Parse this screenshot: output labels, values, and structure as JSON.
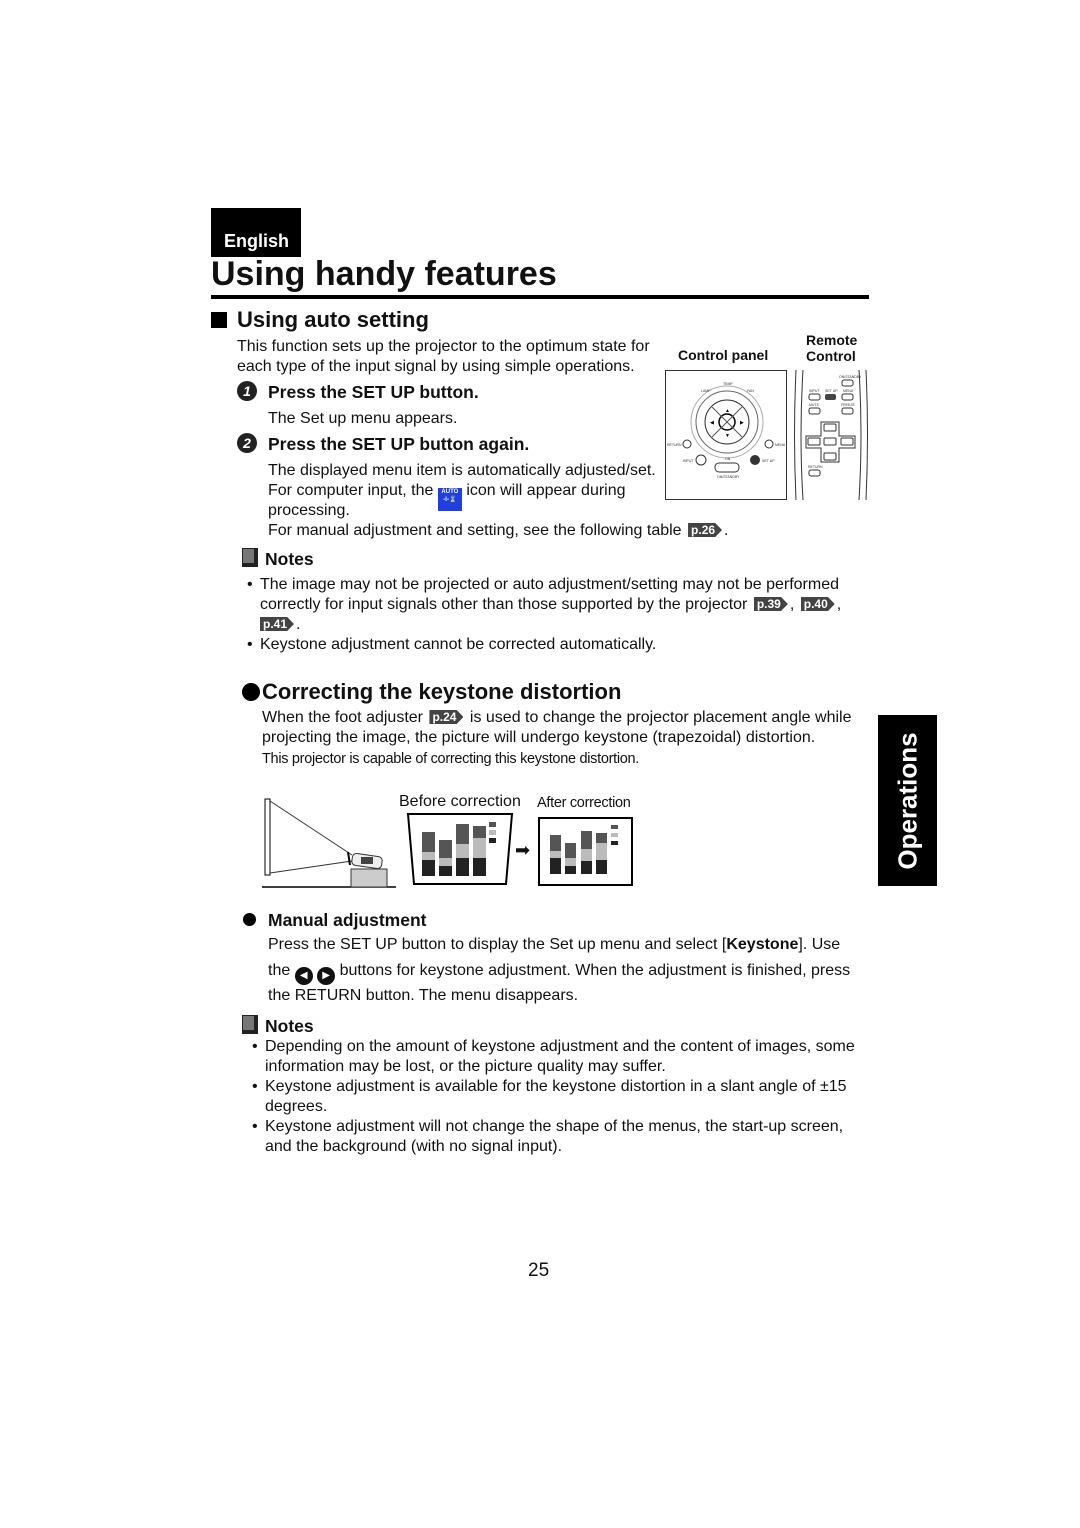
{
  "header": {
    "language_tab": "English",
    "title": "Using handy features"
  },
  "section1": {
    "heading": "Using auto setting",
    "intro": [
      "This function sets up the projector to the optimum state for",
      "each type of the input signal by using simple operations."
    ],
    "control_panel_label": "Control panel",
    "remote_label": [
      "Remote",
      "Control"
    ],
    "control_panel_labels": {
      "lamp": "LAMP",
      "temp": "TEMP",
      "fan": "FAN",
      "return": "RETURN",
      "menu": "MENU",
      "input": "INPUT",
      "on": "ON",
      "setup": "SET UP",
      "standby": "ON/STANDBY"
    },
    "remote_labels": {
      "standby": "ON/STANDBY",
      "input": "INPUT",
      "setup": "SET UP",
      "menu": "MENU",
      "mute": "MUTE",
      "freeze": "FREEZE",
      "return": "RETURN"
    },
    "steps": [
      {
        "number": "1",
        "title": "Press the SET UP button.",
        "lines": [
          "The Set up menu appears."
        ]
      },
      {
        "number": "2",
        "title": "Press the SET UP button again.",
        "lines": [
          "The displayed menu item is automatically adjusted/set."
        ],
        "line2_a": "For computer input, the",
        "line2_b": "icon will appear during",
        "line3": "processing.",
        "line4": "For manual adjustment and setting, see the following table",
        "line4_ref": "p.26",
        "line4_end": "."
      }
    ],
    "auto_icon_text": "AUTO",
    "notes_title": "Notes",
    "notes": [
      {
        "a": "The image may not be projected or auto adjustment/setting may not be performed",
        "b": "correctly for input signals other than those supported by the projector",
        "refs": [
          "p.39",
          "p.40",
          "p.41"
        ]
      },
      {
        "a": "Keystone adjustment cannot be corrected automatically."
      }
    ]
  },
  "section2": {
    "heading": "Correcting the keystone distortion",
    "line1_a": "When the foot adjuster",
    "line1_ref": "p.24",
    "line1_b": "is used to change the projector placement angle while",
    "line2": "projecting the image, the picture will undergo keystone (trapezoidal) distortion.",
    "line3": "This projector is capable of correcting this keystone distortion.",
    "before_label": "Before correction",
    "after_label": "After correction",
    "manual": {
      "title": "Manual adjustment",
      "line1_a": "Press the SET UP button to display the Set up menu and select [",
      "line1_bold": "Keystone",
      "line1_b": "]. Use",
      "line2_a": "the",
      "line2_b": "buttons for keystone adjustment. When the adjustment is finished, press",
      "line3": "the RETURN button. The menu disappears."
    },
    "notes_title": "Notes",
    "notes": [
      [
        "Depending on the amount of keystone adjustment and the content of images, some",
        "information may be lost, or the picture quality may suffer."
      ],
      [
        "Keystone adjustment is available for the keystone distortion in a slant angle of ±15",
        "degrees."
      ],
      [
        "Keystone adjustment will not change the shape of the menus, the start-up screen,",
        "and the background (with no signal input)."
      ]
    ]
  },
  "side_tab": "Operations",
  "page_number": "25",
  "colors": {
    "text": "#111111",
    "tab_bg": "#000000",
    "auto_icon": "#1f3fe0",
    "ref_badge": "#444444"
  }
}
